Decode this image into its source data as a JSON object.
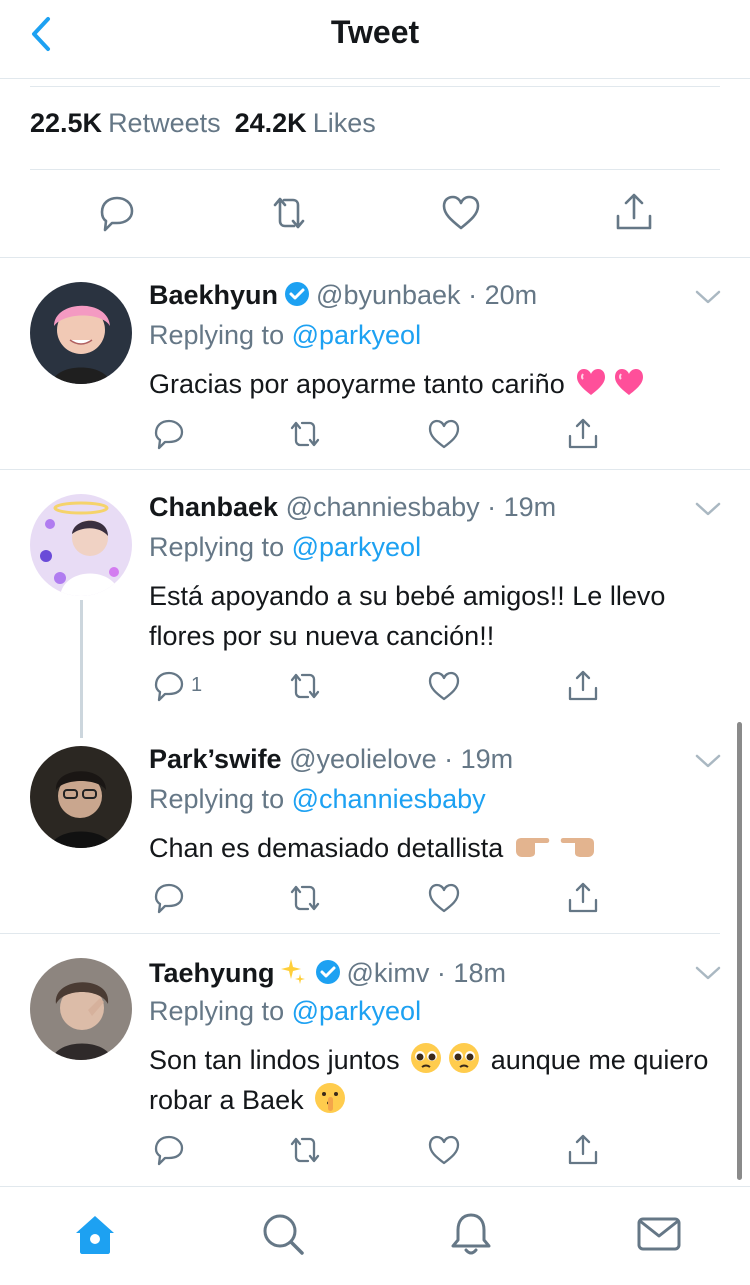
{
  "header": {
    "title": "Tweet"
  },
  "stats": {
    "retweets_count": "22.5K",
    "retweets_label": "Retweets",
    "likes_count": "24.2K",
    "likes_label": "Likes"
  },
  "colors": {
    "accent": "#1da1f2",
    "secondary_text": "#657786",
    "border": "#e1e8ed",
    "heart": "#ff4f9a"
  },
  "replies": [
    {
      "name": "Baekhyun",
      "verified": true,
      "handle": "@byunbaek",
      "time": "20m",
      "replying_label": "Replying to",
      "replying_to": "@parkyeol",
      "text": "Gracias por apoyarme tanto cariño",
      "emojis": [
        "growing-heart-emoji",
        "growing-heart-emoji"
      ]
    },
    {
      "name": "Chanbaek",
      "verified": false,
      "handle": "@channiesbaby",
      "time": "19m",
      "replying_label": "Replying to",
      "replying_to": "@parkyeol",
      "text": "Está apoyando a su bebé amigos!! Le llevo flores por su nueva canción!!",
      "reply_count": "1"
    },
    {
      "name": "Park’swife",
      "verified": false,
      "handle": "@yeolielove",
      "time": "19m",
      "replying_label": "Replying to",
      "replying_to": "@channiesbaby",
      "text": "Chan es demasiado detallista",
      "emojis": [
        "pointing-right-emoji",
        "pointing-left-emoji"
      ]
    },
    {
      "name": "Taehyung",
      "name_emoji": "sparkles-emoji",
      "verified": true,
      "handle": "@kimv",
      "time": "18m",
      "replying_label": "Replying to",
      "replying_to": "@parkyeol",
      "text_a": "Son tan lindos juntos",
      "text_b": "aunque me quiero robar a Baek",
      "emojis": [
        "pleading-face-emoji",
        "pleading-face-emoji",
        "shushing-face-emoji"
      ]
    }
  ],
  "tabs": [
    "home-icon",
    "search-icon",
    "notifications-icon",
    "messages-icon"
  ]
}
